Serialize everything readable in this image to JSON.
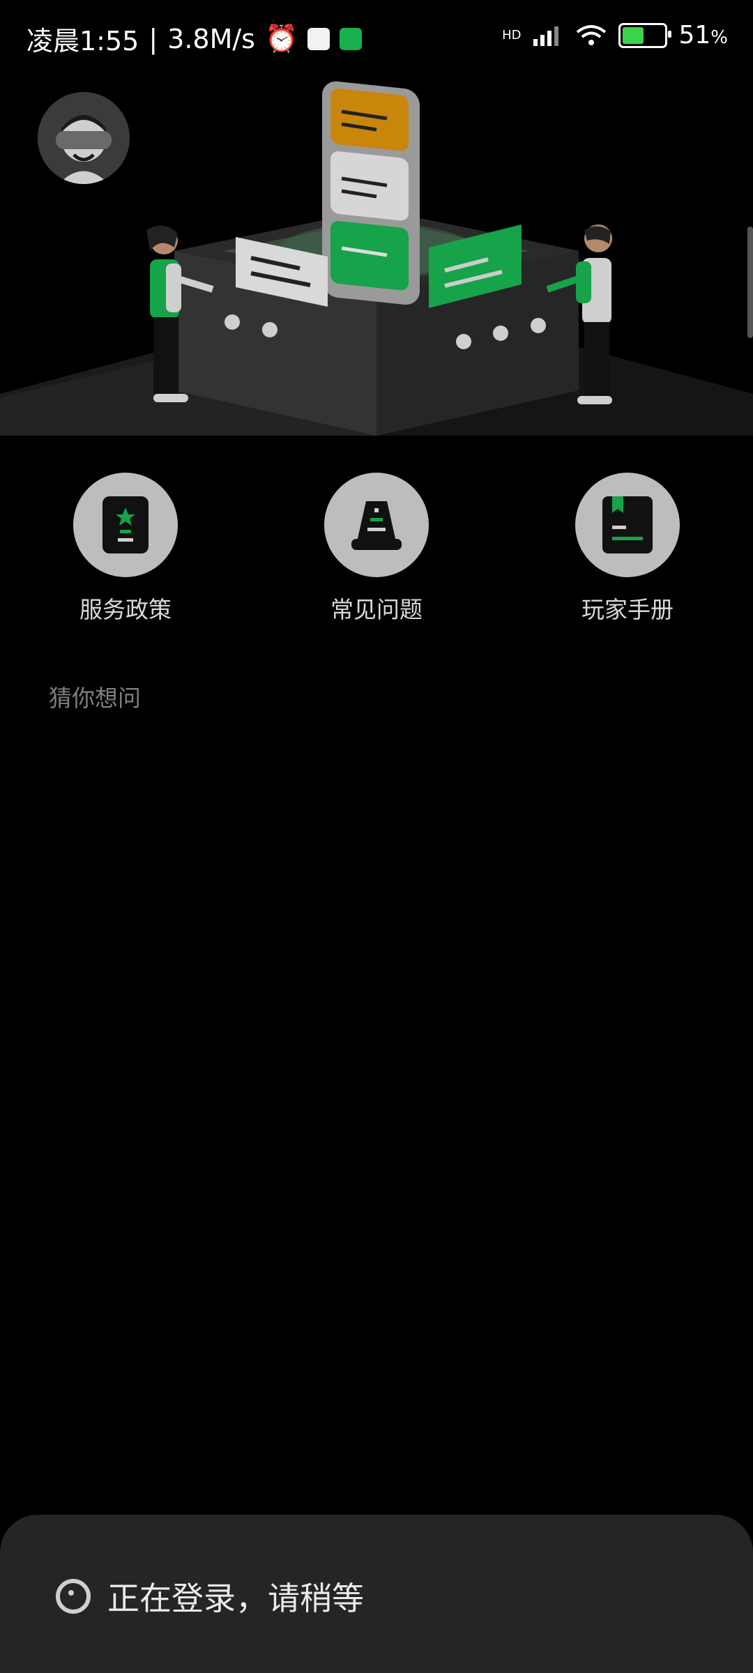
{
  "status_bar": {
    "time": "凌晨1:55",
    "speed": "3.8M/s",
    "network": "HD",
    "battery": "51",
    "battery_unit": "%",
    "battery_level": 0.51,
    "alarm_icon": "alarm-icon",
    "wifi_icon": "wifi-icon",
    "signal_icon": "signal-icon"
  },
  "hero": {
    "avatar_icon": "vr-headset-user-icon"
  },
  "shortcuts": [
    {
      "label": "服务政策",
      "icon": "policy-phone-icon"
    },
    {
      "label": "常见问题",
      "icon": "faq-cone-icon"
    },
    {
      "label": "玩家手册",
      "icon": "handbook-icon"
    }
  ],
  "guess_section": {
    "title": "猜你想问"
  },
  "loading_sheet": {
    "message": "正在登录，请稍等"
  },
  "colors": {
    "background": "#000000",
    "accent_green": "#16a34a",
    "accent_orange": "#c8860a",
    "icon_circle": "#bdbdbd",
    "sheet_bg": "#252525"
  }
}
